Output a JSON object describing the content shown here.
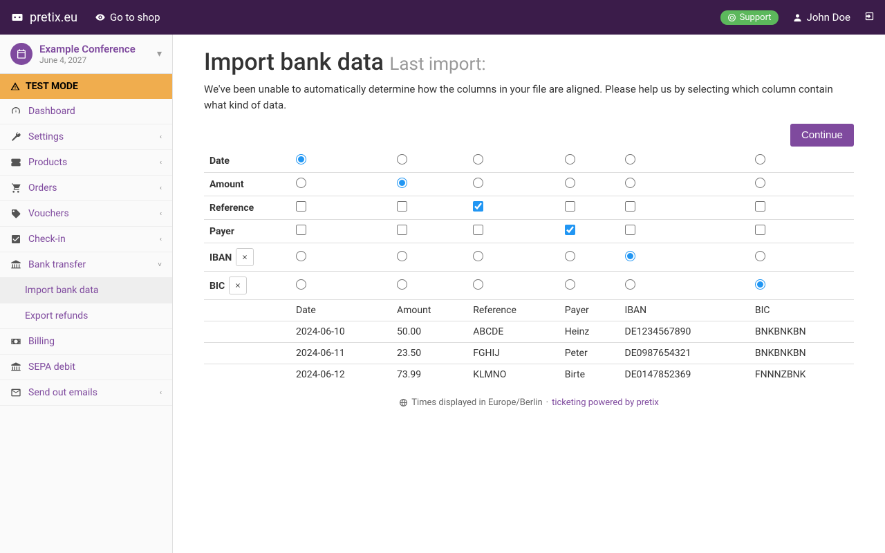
{
  "topbar": {
    "brand": "pretix.eu",
    "shop_link": "Go to shop",
    "support": "Support",
    "user": "John Doe"
  },
  "event": {
    "name": "Example Conference",
    "date": "June 4, 2027"
  },
  "test_mode": "TEST MODE",
  "nav": {
    "dashboard": "Dashboard",
    "settings": "Settings",
    "products": "Products",
    "orders": "Orders",
    "vouchers": "Vouchers",
    "checkin": "Check-in",
    "bank_transfer": "Bank transfer",
    "import_bank_data": "Import bank data",
    "export_refunds": "Export refunds",
    "billing": "Billing",
    "sepa_debit": "SEPA debit",
    "send_emails": "Send out emails"
  },
  "page": {
    "title": "Import bank data",
    "subtitle": "Last import:",
    "intro": "We've been unable to automatically determine how the columns in your file are aligned. Please help us by selecting which column contain what kind of data.",
    "continue": "Continue"
  },
  "mapping": {
    "rows": [
      {
        "label": "Date",
        "type": "radio",
        "removable": false,
        "selected": 0
      },
      {
        "label": "Amount",
        "type": "radio",
        "removable": false,
        "selected": 1
      },
      {
        "label": "Reference",
        "type": "checkbox",
        "removable": false,
        "selected": 2
      },
      {
        "label": "Payer",
        "type": "checkbox",
        "removable": false,
        "selected": 3
      },
      {
        "label": "IBAN",
        "type": "radio",
        "removable": true,
        "selected": 4
      },
      {
        "label": "BIC",
        "type": "radio",
        "removable": true,
        "selected": 5
      }
    ],
    "num_cols": 6,
    "preview_headers": [
      "Date",
      "Amount",
      "Reference",
      "Payer",
      "IBAN",
      "BIC"
    ],
    "preview_rows": [
      [
        "2024-06-10",
        "50.00",
        "ABCDE",
        "Heinz",
        "DE1234567890",
        "BNKBNKBN"
      ],
      [
        "2024-06-11",
        "23.50",
        "FGHIJ",
        "Peter",
        "DE0987654321",
        "BNKBNKBN"
      ],
      [
        "2024-06-12",
        "73.99",
        "KLMNO",
        "Birte",
        "DE0147852369",
        "FNNNZBNK"
      ]
    ]
  },
  "footer": {
    "tz": "Times displayed in Europe/Berlin",
    "sep": " · ",
    "powered": "ticketing powered by pretix"
  }
}
